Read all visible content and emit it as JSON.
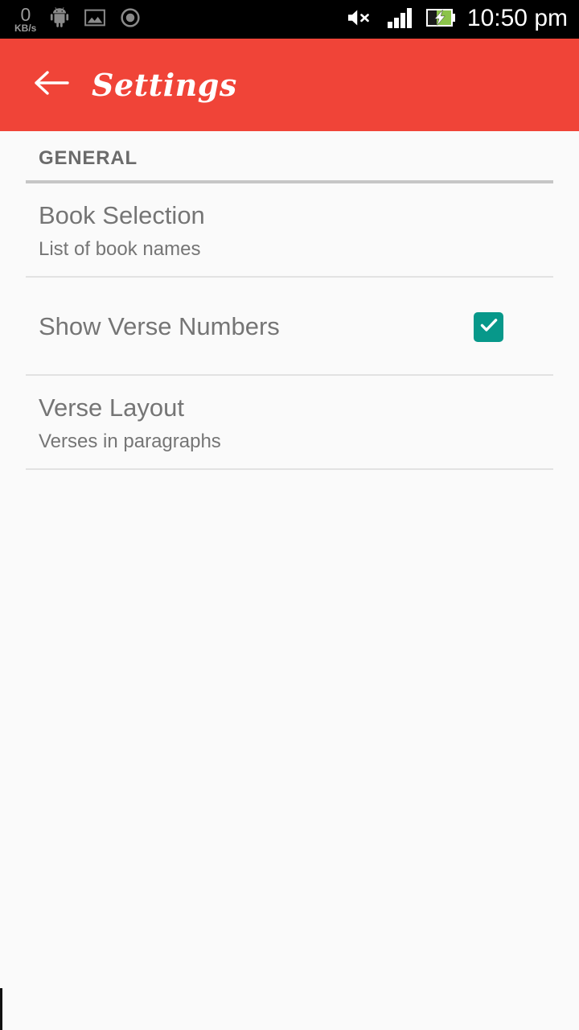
{
  "status_bar": {
    "network_speed_value": "0",
    "network_speed_unit": "KB/s",
    "icons_left": [
      "android-icon",
      "image-icon",
      "record-circle-icon"
    ],
    "icons_right": [
      "volume-mute-icon",
      "signal-bars-icon",
      "battery-charging-icon"
    ],
    "clock": "10:50 pm",
    "background_color": "#000000",
    "text_color": "#ffffff"
  },
  "app_bar": {
    "title": "Settings",
    "back_icon": "arrow-left-icon",
    "background_color": "#f04438",
    "title_color": "#ffffff"
  },
  "content": {
    "sections": [
      {
        "header": "GENERAL",
        "items": [
          {
            "title": "Book Selection",
            "summary": "List of book names",
            "control": "none"
          },
          {
            "title": "Show Verse Numbers",
            "summary": "",
            "control": "checkbox",
            "checked": true,
            "checkbox_color": "#07988a",
            "check_glyph": "check-icon"
          },
          {
            "title": "Verse Layout",
            "summary": "Verses in paragraphs",
            "control": "none"
          }
        ]
      }
    ],
    "background_color": "#fafafa",
    "text_color": "#757575",
    "divider_color": "#e2e2e2"
  }
}
